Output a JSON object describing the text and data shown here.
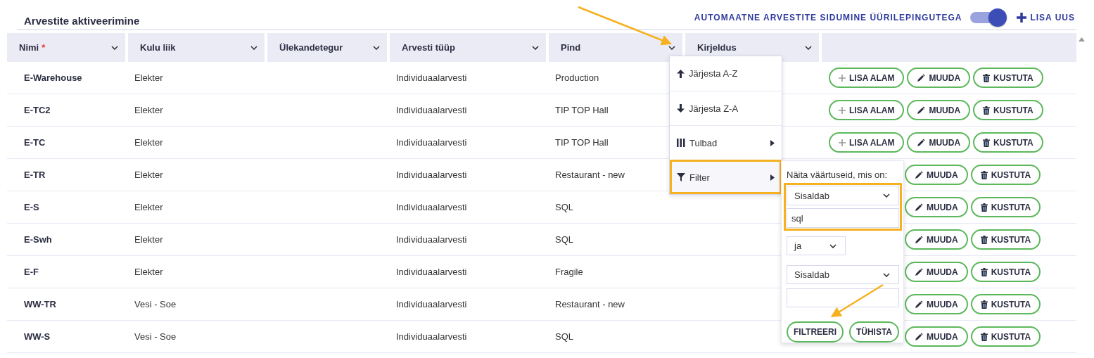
{
  "title": "Arvestite aktiveerimine",
  "auto_link": {
    "label": "AUTOMAATNE ARVESTITE SIDUMINE ÜÜRILEPINGUTEGA",
    "on": true
  },
  "add_button": "LISA UUS",
  "columns": [
    {
      "label": "Nimi",
      "required_mark": "*"
    },
    {
      "label": "Kulu liik"
    },
    {
      "label": "Ülekandetegur"
    },
    {
      "label": "Arvesti tüüp"
    },
    {
      "label": "Pind"
    },
    {
      "label": "Kirjeldus"
    }
  ],
  "rows": [
    {
      "name": "E-Warehouse",
      "cost_type": "Elekter",
      "meter_type": "Individuaalarvesti",
      "area": "Production",
      "actions": [
        "LISA ALAM",
        "MUUDA",
        "KUSTUTA"
      ]
    },
    {
      "name": "E-TC2",
      "cost_type": "Elekter",
      "meter_type": "Individuaalarvesti",
      "area": "TIP TOP Hall",
      "actions": [
        "LISA ALAM",
        "MUUDA",
        "KUSTUTA"
      ]
    },
    {
      "name": "E-TC",
      "cost_type": "Elekter",
      "meter_type": "Individuaalarvesti",
      "area": "TIP TOP Hall",
      "actions": [
        "LISA ALAM",
        "MUUDA",
        "KUSTUTA"
      ]
    },
    {
      "name": "E-TR",
      "cost_type": "Elekter",
      "meter_type": "Individuaalarvesti",
      "area": "Restaurant - new",
      "actions": [
        "MUUDA",
        "KUSTUTA"
      ]
    },
    {
      "name": "E-S",
      "cost_type": "Elekter",
      "meter_type": "Individuaalarvesti",
      "area": "SQL",
      "actions": [
        "MUUDA",
        "KUSTUTA"
      ]
    },
    {
      "name": "E-Swh",
      "cost_type": "Elekter",
      "meter_type": "Individuaalarvesti",
      "area": "SQL",
      "actions": [
        "MUUDA",
        "KUSTUTA"
      ]
    },
    {
      "name": "E-F",
      "cost_type": "Elekter",
      "meter_type": "Individuaalarvesti",
      "area": "Fragile",
      "actions": [
        "MUUDA",
        "KUSTUTA"
      ]
    },
    {
      "name": "WW-TR",
      "cost_type": "Vesi - Soe",
      "meter_type": "Individuaalarvesti",
      "area": "Restaurant - new",
      "actions": [
        "MUUDA",
        "KUSTUTA"
      ]
    },
    {
      "name": "WW-S",
      "cost_type": "Vesi - Soe",
      "meter_type": "Individuaalarvesti",
      "area": "SQL",
      "actions": [
        "MUUDA",
        "KUSTUTA"
      ]
    }
  ],
  "column_menu": [
    {
      "label": "Järjesta A-Z",
      "kind": "sort-up",
      "highlighted": false
    },
    {
      "label": "Järjesta Z-A",
      "kind": "sort-down",
      "highlighted": false
    },
    {
      "label": "Tulbad",
      "kind": "columns",
      "highlighted": false
    },
    {
      "label": "Filter",
      "kind": "filter",
      "highlighted": true
    }
  ],
  "filter": {
    "label": "Näita väärtuseid, mis on:",
    "condition_1": "Sisaldab",
    "value_1": "sql",
    "operator": "ja",
    "condition_2": "Sisaldab",
    "buttons": [
      "FILTREERI",
      "TÜHISTA"
    ]
  }
}
